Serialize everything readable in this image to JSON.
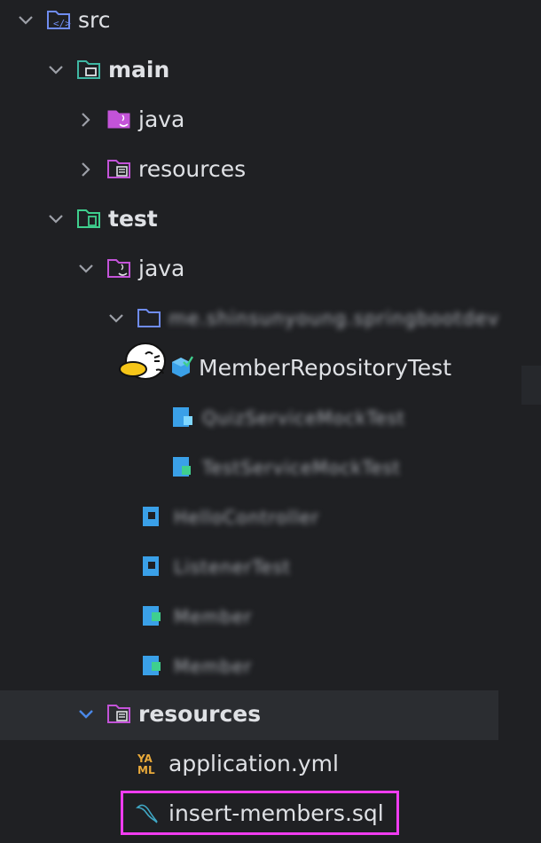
{
  "tree": {
    "src": "src",
    "main": "main",
    "main_java": "java",
    "main_resources": "resources",
    "test": "test",
    "test_java": "java",
    "package": "me.shinsunyoung.springbootdev",
    "test_class": "MemberRepositoryTest",
    "blurred_1": "QuizServiceMockTest",
    "blurred_2": "TestServiceMockTest",
    "blurred_3": "HelloController",
    "blurred_4": "ListenerTest",
    "blurred_5": "Member",
    "blurred_6": "Member",
    "test_resources": "resources",
    "yaml_file": "application.yml",
    "sql_file": "insert-members.sql"
  },
  "icons": {
    "source_root": "source-root-folder-icon",
    "module_folder": "module-folder-icon",
    "java_folder": "java-source-folder-icon",
    "resources_folder": "resources-folder-icon",
    "package_folder": "package-folder-icon",
    "test_class": "test-class-icon",
    "yaml": "yaml-file-icon",
    "sql": "sql-file-icon"
  },
  "colors": {
    "background": "#1f2023",
    "selected_row": "#2b2d31",
    "highlight": "#f03cf0",
    "text": "#dfe1e5",
    "chevron": "#9da0a8",
    "chevron_active": "#4a88e8"
  }
}
